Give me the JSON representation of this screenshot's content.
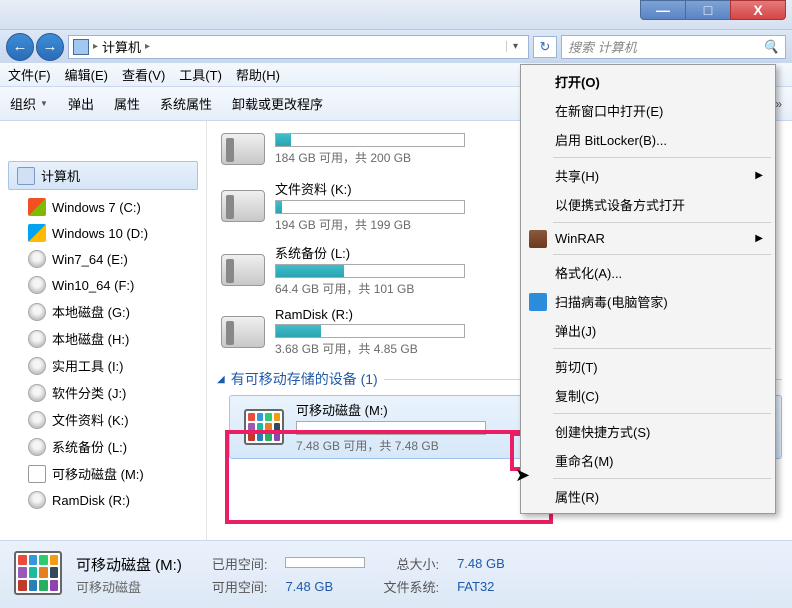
{
  "window": {
    "min": "—",
    "max": "□",
    "close": "X"
  },
  "nav": {
    "back": "←",
    "forward": "→",
    "breadcrumb_sep": "▸",
    "breadcrumb": "计算机",
    "refresh": "↻",
    "search_placeholder": "搜索 计算机",
    "search_icon": "🔍"
  },
  "menu": {
    "file": "文件(F)",
    "edit": "编辑(E)",
    "view": "查看(V)",
    "tools": "工具(T)",
    "help": "帮助(H)"
  },
  "toolbar": {
    "organize": "组织",
    "eject": "弹出",
    "properties": "属性",
    "sys_props": "系统属性",
    "uninstall": "卸载或更改程序",
    "more": "»"
  },
  "sidebar": {
    "root": "计算机",
    "items": [
      {
        "label": "Windows 7 (C:)"
      },
      {
        "label": "Windows 10 (D:)"
      },
      {
        "label": "Win7_64 (E:)"
      },
      {
        "label": "Win10_64 (F:)"
      },
      {
        "label": "本地磁盘 (G:)"
      },
      {
        "label": "本地磁盘 (H:)"
      },
      {
        "label": "实用工具 (I:)"
      },
      {
        "label": "软件分类 (J:)"
      },
      {
        "label": "文件资料 (K:)"
      },
      {
        "label": "系统备份 (L:)"
      },
      {
        "label": "可移动磁盘 (M:)"
      },
      {
        "label": "RamDisk (R:)"
      }
    ]
  },
  "drives": [
    {
      "stats": "184 GB 可用，共 200 GB",
      "fill": 8
    },
    {
      "name": "文件资料 (K:)",
      "stats": "194 GB 可用，共 199 GB",
      "fill": 3
    },
    {
      "name": "系统备份 (L:)",
      "stats": "64.4 GB 可用，共 101 GB",
      "fill": 36
    },
    {
      "name": "RamDisk (R:)",
      "stats": "3.68 GB 可用，共 4.85 GB",
      "fill": 24
    }
  ],
  "group": {
    "title": "有可移动存储的设备 (1)"
  },
  "removable": {
    "name": "可移动磁盘 (M:)",
    "stats": "7.48 GB 可用，共 7.48 GB"
  },
  "context": {
    "open": "打开(O)",
    "open_new": "在新窗口中打开(E)",
    "bitlocker": "启用 BitLocker(B)...",
    "share": "共享(H)",
    "portable": "以便携式设备方式打开",
    "winrar": "WinRAR",
    "format": "格式化(A)...",
    "scan": "扫描病毒(电脑管家)",
    "eject": "弹出(J)",
    "cut": "剪切(T)",
    "copy": "复制(C)",
    "shortcut": "创建快捷方式(S)",
    "rename": "重命名(M)",
    "properties": "属性(R)"
  },
  "status": {
    "title": "可移动磁盘 (M:)",
    "subtitle": "可移动磁盘",
    "used_label": "已用空间:",
    "free_label": "可用空间:",
    "free_val": "7.48 GB",
    "total_label": "总大小:",
    "total_val": "7.48 GB",
    "fs_label": "文件系统:",
    "fs_val": "FAT32"
  }
}
